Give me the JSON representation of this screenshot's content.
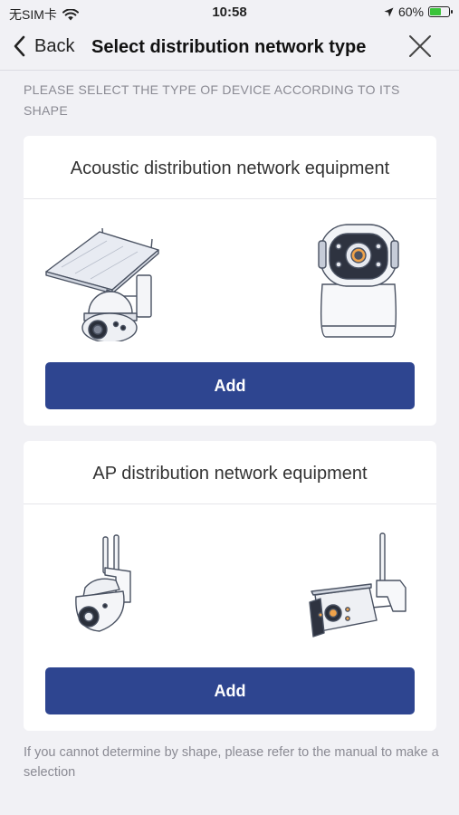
{
  "status_bar": {
    "carrier": "无SIM卡",
    "time": "10:58",
    "battery": "60%",
    "battery_level": 0.6
  },
  "nav": {
    "back_label": "Back",
    "title": "Select distribution network type"
  },
  "hint": "PLEASE SELECT THE TYPE OF DEVICE ACCORDING TO ITS SHAPE",
  "cards": [
    {
      "title": "Acoustic distribution network equipment",
      "devices": [
        "solar-ptz-camera",
        "indoor-pan-tilt-camera"
      ],
      "add_label": "Add"
    },
    {
      "title": "AP distribution network equipment",
      "devices": [
        "dual-antenna-dome-camera",
        "antenna-bullet-camera"
      ],
      "add_label": "Add"
    }
  ],
  "footer": "If you cannot determine by shape, please refer to the manual to make a selection",
  "colors": {
    "background": "#f1f1f5",
    "button": "#2e4590",
    "hint_text": "#8a8a93"
  }
}
